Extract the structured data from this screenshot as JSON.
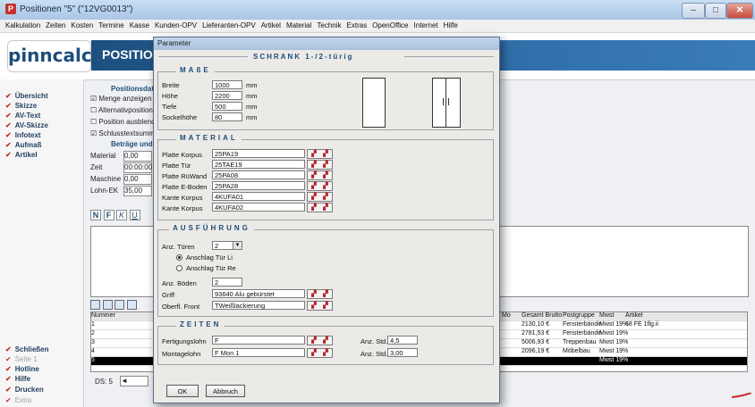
{
  "window": {
    "title": "Positionen \"5\" (\"12VG0013\")",
    "buttons": [
      "–",
      "□",
      "✕"
    ]
  },
  "menu": [
    "Kalkulation",
    "Zeiten",
    "Kosten",
    "Termine",
    "Kasse",
    "Kunden-OPV",
    "Lieferanten-OPV",
    "Artikel",
    "Material",
    "Technik",
    "Extras",
    "OpenOffice",
    "Internet",
    "Hilfe"
  ],
  "header": {
    "logo": "pinncalc",
    "banner": "POSITIONE"
  },
  "nav": {
    "top": [
      "Übersicht",
      "Skizze",
      "AV-Text",
      "AV-Skizze",
      "Infotext",
      "Aufmaß",
      "Artikel"
    ],
    "bottom": [
      "Schließen",
      "Seite 1",
      "Hotline",
      "Hilfe",
      "Drucken",
      "Extra"
    ]
  },
  "background": {
    "position_title": "Positionsdat",
    "checks": [
      "Menge anzeigen",
      "Alternativposition",
      "Position ausblende",
      "Schlusstextsumme"
    ],
    "betraege_title": "Beträge und",
    "fields": [
      {
        "label": "Material",
        "value": "0,00"
      },
      {
        "label": "Zeit",
        "value": "00:00:00"
      },
      {
        "label": "Maschine",
        "value": "0,00"
      },
      {
        "label": "Lohn-EK",
        "value": "35,00"
      }
    ],
    "fmt_buttons": [
      "N",
      "F",
      "K",
      "U"
    ],
    "grid_header": [
      "Nummer"
    ],
    "grid_rows": [
      "1",
      "2",
      "3",
      "4",
      "5"
    ],
    "ds_label": "DS: 5",
    "right_headers": [
      "Mo",
      "Gesamt Brutto",
      "Postgruppe",
      "Mwst",
      "Artikel"
    ],
    "right_rows": [
      {
        "brutto": "2130,10 €",
        "gruppe": "Fensterbände",
        "mwst": "Mwst 19%",
        "artikel": "68 FE 1flg.ii"
      },
      {
        "brutto": "2781,53 €",
        "gruppe": "Fensterbände",
        "mwst": "Mwst 19%",
        "artikel": ""
      },
      {
        "brutto": "5006,93 €",
        "gruppe": "Treppenbau",
        "mwst": "Mwst 19%",
        "artikel": ""
      },
      {
        "brutto": "2096,19 €",
        "gruppe": "Möbelbau",
        "mwst": "Mwst 19%",
        "artikel": ""
      },
      {
        "brutto": "",
        "gruppe": "",
        "mwst": "Mwst 19%",
        "artikel": ""
      }
    ]
  },
  "dialog": {
    "title": "Parameter",
    "heading": "SCHRANK 1-/2-türig",
    "masse": {
      "title": "MAßE",
      "fields": [
        {
          "label": "Breite",
          "value": "1000",
          "unit": "mm"
        },
        {
          "label": "Höhe",
          "value": "2200",
          "unit": "mm"
        },
        {
          "label": "Tiefe",
          "value": "500",
          "unit": "mm"
        },
        {
          "label": "Sockelhöhe",
          "value": "80",
          "unit": "mm"
        }
      ]
    },
    "material": {
      "title": "MATERIAL",
      "fields": [
        {
          "label": "Platte Korpus",
          "value": "25PA19"
        },
        {
          "label": "Platte Tür",
          "value": "25TAE19"
        },
        {
          "label": "Platte RüWand",
          "value": "25PA08"
        },
        {
          "label": "Platte E-Boden",
          "value": "25PA28"
        },
        {
          "label": "Kante Korpus",
          "value": "4KUFA01"
        },
        {
          "label": "Kante Korpus",
          "value": "4KUFA02"
        }
      ]
    },
    "ausfuehrung": {
      "title": "AUSFÜHRUNG",
      "anz_tueren_label": "Anz. Türen",
      "anz_tueren_value": "2",
      "radio_li": "Anschlag Tür Li",
      "radio_re": "Anschlag Tür Re",
      "anz_boeden_label": "Anz. Böden",
      "anz_boeden_value": "2",
      "griff_label": "Griff",
      "griff_value": "93640 Alu gebürstet",
      "oberfl_label": "Oberfl. Front",
      "oberfl_value": "TWeißlackierung"
    },
    "zeiten": {
      "title": "ZEITEN",
      "rows": [
        {
          "label": "Fertigungslohn",
          "value": "F",
          "std_label": "Anz. Std.",
          "std_value": "4,5"
        },
        {
          "label": "Montagelohn",
          "value": "F Mon 1",
          "std_label": "Anz. Std.",
          "std_value": "3,00"
        }
      ]
    },
    "ok": "OK",
    "cancel": "Abbruch"
  }
}
